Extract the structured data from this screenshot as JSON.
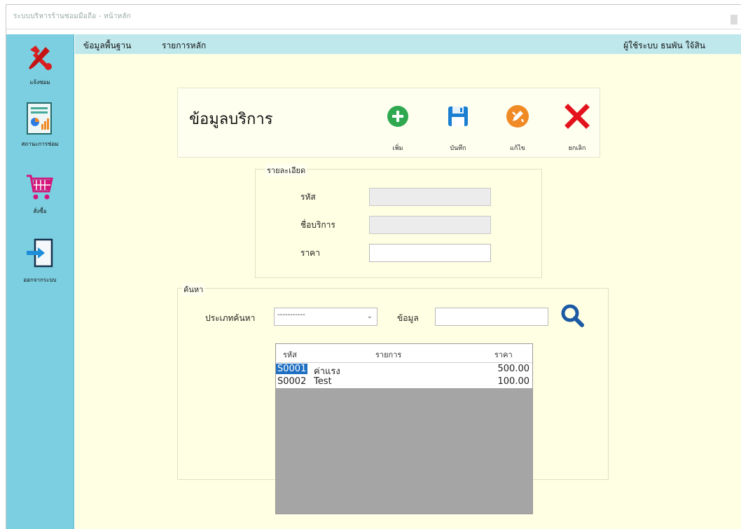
{
  "window": {
    "title": "ระบบบริหารร้านซ่อมมือถือ - หน้าหลัก"
  },
  "menu": {
    "items": [
      "ข้อมูลพื้นฐาน",
      "รายการหลัก"
    ],
    "user_text": "ผู้ใช้ระบบ ธนพัน ใจ้สิน"
  },
  "sidebar": {
    "items": [
      {
        "label": "แจ้งซ่อม",
        "icon": "repair-tools-icon"
      },
      {
        "label": "สถานะการซ่อม",
        "icon": "report-chart-icon"
      },
      {
        "label": "สั่งซื้อ",
        "icon": "shopping-cart-icon"
      },
      {
        "label": "ออกจากระบบ",
        "icon": "exit-door-icon"
      }
    ]
  },
  "form": {
    "title": "ข้อมูลบริการ",
    "toolbar": [
      {
        "label": "เพิ่ม",
        "icon": "add-icon"
      },
      {
        "label": "บันทึก",
        "icon": "save-icon"
      },
      {
        "label": "แก้ไข",
        "icon": "edit-icon"
      },
      {
        "label": "ยกเลิก",
        "icon": "cancel-icon"
      }
    ],
    "details": {
      "group_title": "รายละเอียด",
      "code_label": "รหัส",
      "code_value": "",
      "name_label": "ชื่อบริการ",
      "name_value": "",
      "price_label": "ราคา",
      "price_value": ""
    },
    "search": {
      "group_title": "ค้นหา",
      "type_label": "ประเภทค้นหา",
      "type_selected": "-----------",
      "data_label": "ข้อมูล",
      "data_value": "",
      "button_icon": "search-icon"
    },
    "table": {
      "columns": [
        "รหัส",
        "รายการ",
        "ราคา"
      ],
      "rows": [
        [
          "S0001",
          "ค่าแรง",
          "500.00"
        ],
        [
          "S0002",
          "Test",
          "100.00"
        ]
      ]
    }
  },
  "colors": {
    "accent": "#1f6fc2",
    "sidebar": "#7ccfe0",
    "menubar": "#bfe8ec",
    "content_bg": "#ffffe3"
  }
}
